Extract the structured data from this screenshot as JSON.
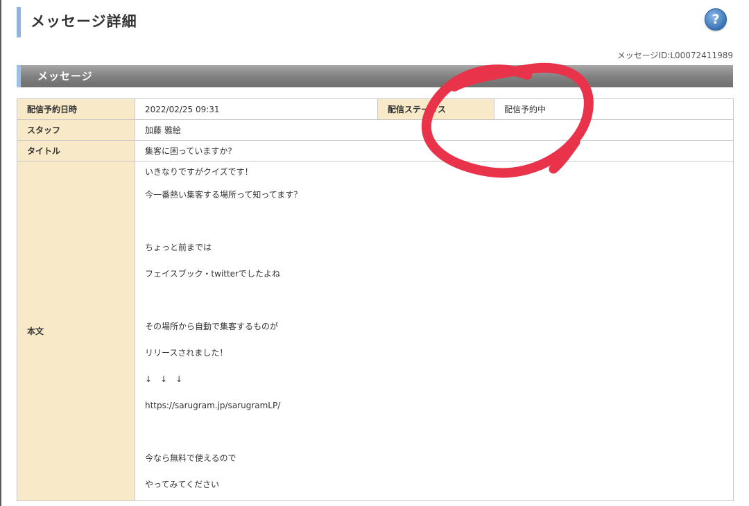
{
  "page": {
    "title": "メッセージ詳細",
    "help_icon": "question-icon",
    "message_id": "メッセージID:L00072411989"
  },
  "section": {
    "title": "メッセージ"
  },
  "details": {
    "schedule_label": "配信予約日時",
    "schedule_value": "2022/02/25 09:31",
    "status_label": "配信ステータス",
    "status_value": "配信予約中",
    "staff_label": "スタッフ",
    "staff_value": "加藤 雅絵",
    "title_label": "タイトル",
    "title_value": "集客に困っていますか?",
    "body_label": "本文",
    "body_lines": [
      "いきなりですがクイズです！",
      "今一番熱い集客する場所って知ってます？",
      "",
      "ちょっと前までは",
      "フェイスブック・twitterでしたよね",
      "",
      "その場所から自動で集客するものが",
      "リリースされました！",
      "↓　↓　↓",
      "https://sarugram.jp/sarugramLP/",
      "",
      "今なら無料で使えるので",
      "やってみてください"
    ]
  },
  "annotation": {
    "color": "#e8334a",
    "shape": "hand-drawn circle"
  },
  "colors": {
    "header_cell": "#f8eac8",
    "section_bar": "#7f7f7f",
    "accent": "#8fb4de"
  }
}
